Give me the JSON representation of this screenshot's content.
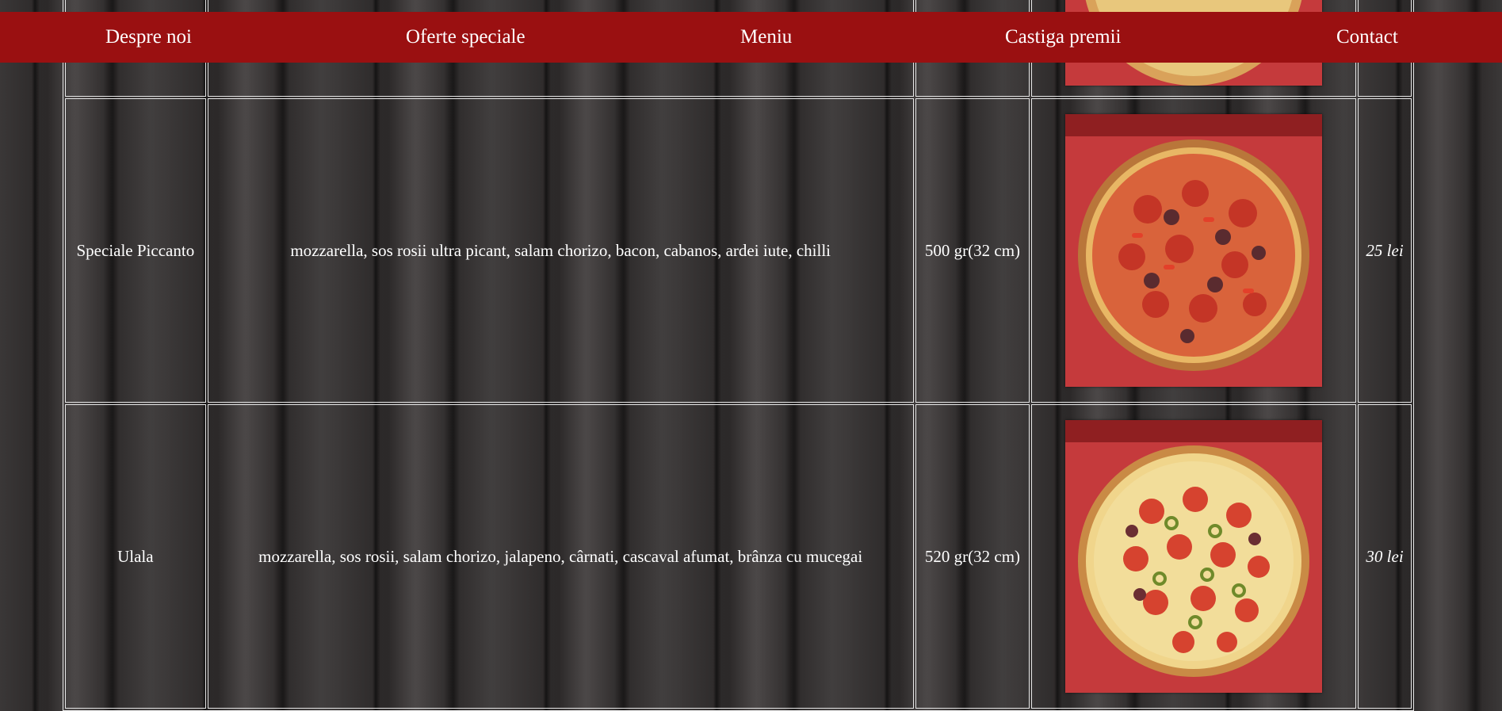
{
  "nav": {
    "items": [
      {
        "label": "Despre noi"
      },
      {
        "label": "Oferte speciale"
      },
      {
        "label": "Meniu"
      },
      {
        "label": "Castiga premii"
      },
      {
        "label": "Contact"
      }
    ]
  },
  "menu": {
    "rows": [
      {
        "name": "Speciale Piccanto",
        "ingredients": "mozzarella, sos rosii ultra picant, salam chorizo, bacon, cabanos, ardei iute, chilli",
        "weight": "500 gr(32 cm)",
        "image": "pizza-picante-image",
        "price": "25 lei"
      },
      {
        "name": "Ulala",
        "ingredients": "mozzarella, sos rosii, salam chorizo, jalapeno, cârnati, cascaval afumat, brânza cu mucegai",
        "weight": "520 gr(32 cm)",
        "image": "pizza-ulala-image",
        "price": "30 lei"
      }
    ]
  },
  "colors": {
    "navbar": "#9a1011",
    "pizza_box": "#c53a3c",
    "table_border": "#e8e8e8"
  }
}
